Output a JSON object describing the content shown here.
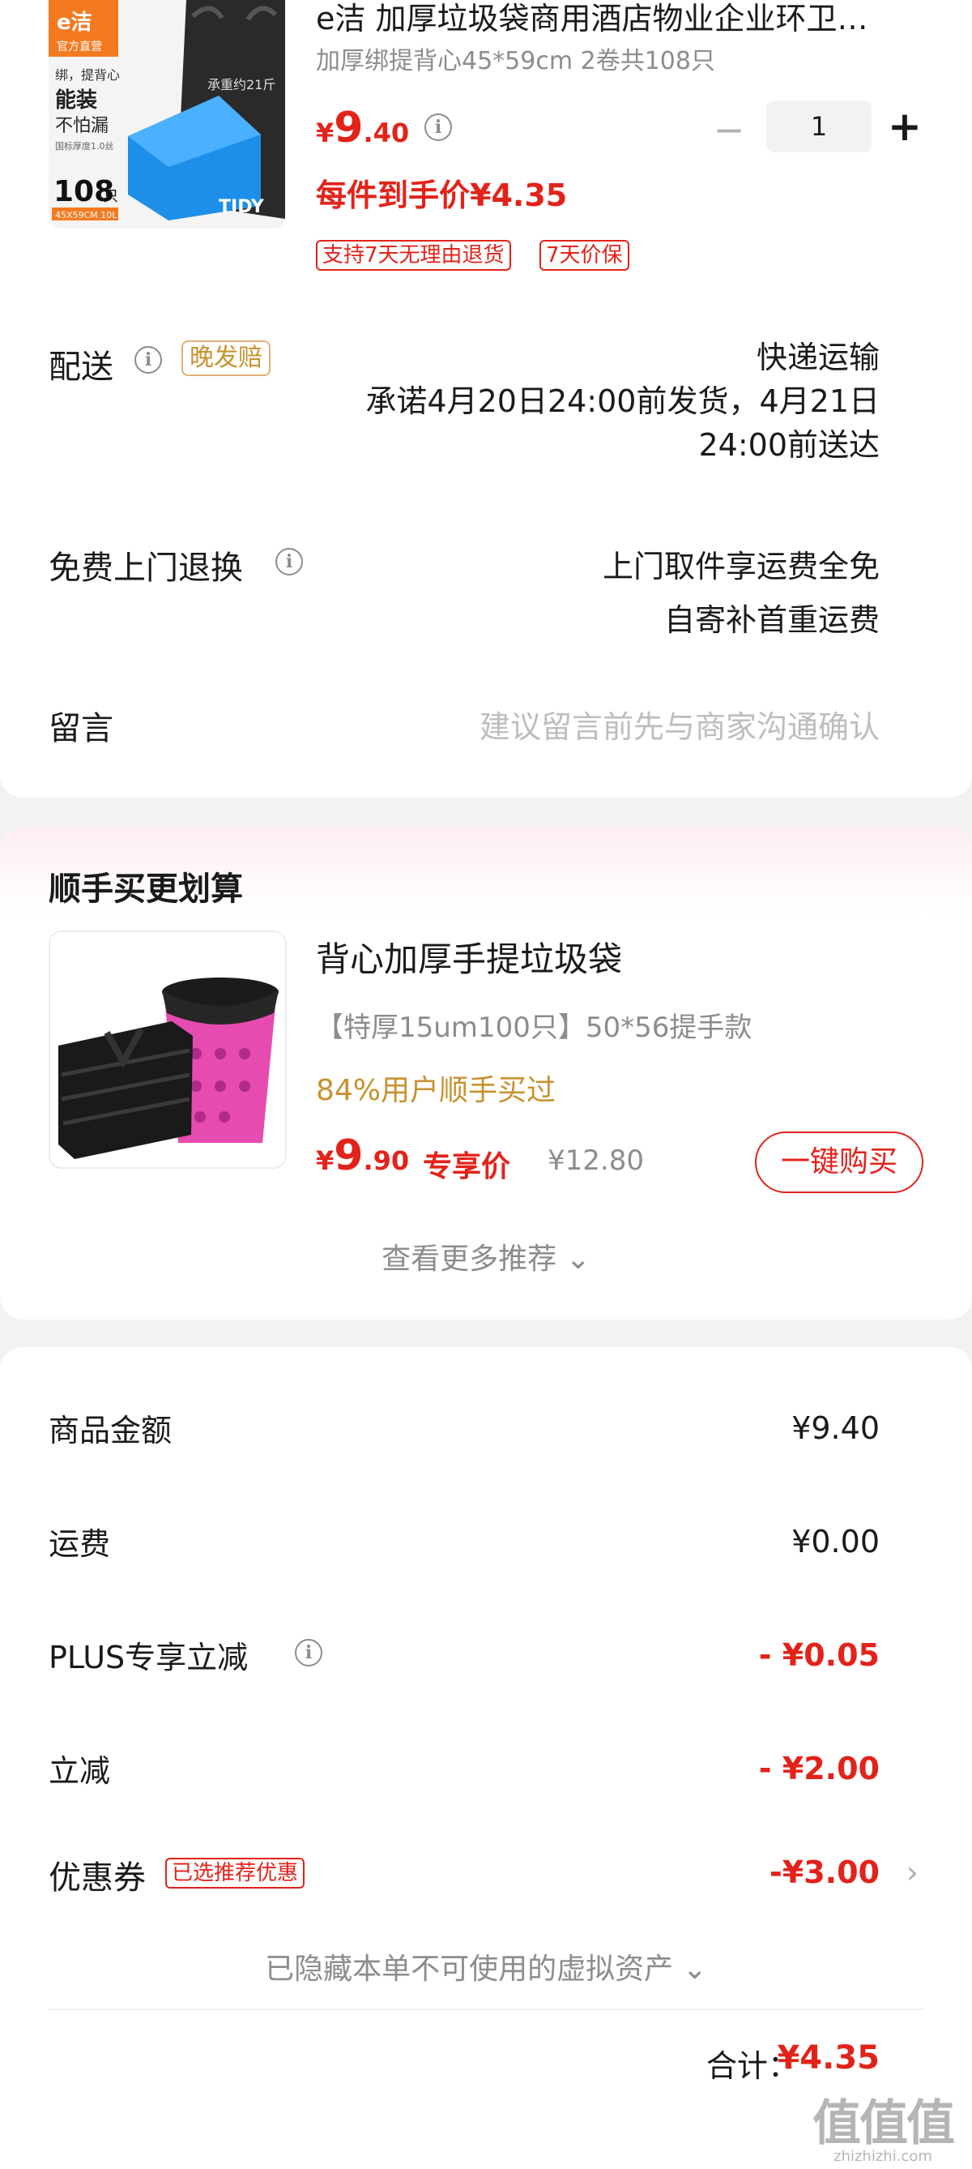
{
  "product": {
    "title": "e洁 加厚垃圾袋商用酒店物业企业环卫…",
    "spec": "加厚绑提背心45*59cm 2卷共108只",
    "price_symbol": "¥",
    "price_int": "9",
    "price_dec": ".40",
    "quantity": "1",
    "unit_price_text": "每件到手价¥4.35",
    "tags": [
      "支持7天无理由退货",
      "7天价保"
    ],
    "image": {
      "brand": "e洁",
      "brand_sub": "官方直营",
      "line1": "绑，提背心",
      "line2": "能装",
      "line3": "不怕漏",
      "line4": "国标厚度1.0丝",
      "count": "108",
      "count_unit": "只",
      "size": "45X59CM 10L",
      "bag_text": "承重约21斤",
      "box_text": "TIDY"
    }
  },
  "delivery": {
    "label": "配送",
    "late_tag": "晚发赔",
    "method": "快递运输",
    "promise_line1": "承诺4月20日24:00前发货，4月21日",
    "promise_line2": "24:00前送达"
  },
  "returns": {
    "label": "免费上门退换",
    "line1": "上门取件享运费全免",
    "line2": "自寄补首重运费"
  },
  "note": {
    "label": "留言",
    "placeholder": "建议留言前先与商家沟通确认"
  },
  "addon": {
    "section_title": "顺手买更划算",
    "title": "背心加厚手提垃圾袋",
    "spec": "【特厚15um100只】50*56提手款",
    "buyers": "84%用户顺手买过",
    "price_symbol": "¥",
    "price_int": "9",
    "price_dec": ".90",
    "exclusive_label": "专享价",
    "original_price": "¥12.80",
    "buy_button": "一键购买",
    "more_label": "查看更多推荐",
    "more_chevron": "⌄"
  },
  "summary": {
    "items": [
      {
        "label": "商品金额",
        "value": "¥9.40"
      },
      {
        "label": "运费",
        "value": "¥0.00"
      },
      {
        "label": "PLUS专享立减",
        "value": "- ¥0.05"
      },
      {
        "label": "立减",
        "value": "- ¥2.00"
      },
      {
        "label": "优惠券",
        "value": "-¥3.00"
      }
    ],
    "coupon_tag": "已选推荐优惠",
    "hidden_assets": "已隐藏本单不可使用的虚拟资产",
    "total_label": "合计：",
    "total_value": "¥4.35"
  },
  "watermark": {
    "glyph": "值值值",
    "url": "zhizhizhi.com"
  },
  "colors": {
    "accent_red": "#e2231a",
    "gold": "#c8912f",
    "muted": "#8c8c8c"
  },
  "icons": [
    "info-icon",
    "minus-icon",
    "plus-icon",
    "chevron-down-icon",
    "chevron-right-icon"
  ]
}
